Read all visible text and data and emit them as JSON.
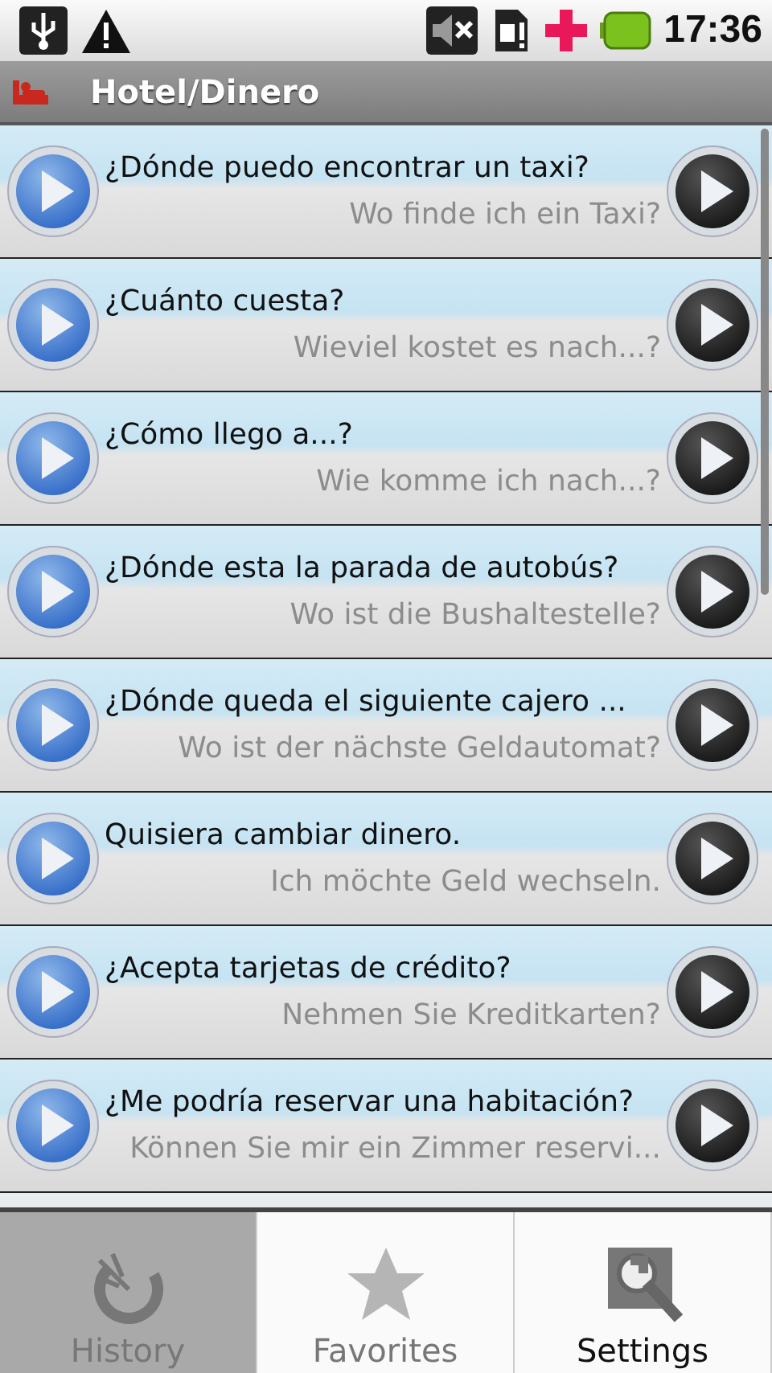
{
  "status_bar": {
    "time": "17:36"
  },
  "title_bar": {
    "title": "Hotel/Dinero"
  },
  "phrases": [
    {
      "question": "¿Dónde puedo encontrar un taxi?",
      "translation": "Wo finde ich ein Taxi?"
    },
    {
      "question": "¿Cuánto cuesta?",
      "translation": "Wieviel kostet es nach...?"
    },
    {
      "question": "¿Cómo llego a...?",
      "translation": "Wie komme ich nach...?"
    },
    {
      "question": "¿Dónde esta la parada de autobús?",
      "translation": "Wo ist die Bushaltestelle?"
    },
    {
      "question": "¿Dónde queda el siguiente cajero ...",
      "translation": "Wo ist der nächste Geldautomat?"
    },
    {
      "question": "Quisiera cambiar dinero.",
      "translation": "Ich möchte Geld wechseln."
    },
    {
      "question": "¿Acepta tarjetas de crédito?",
      "translation": "Nehmen Sie Kreditkarten?"
    },
    {
      "question": "¿Me podría reservar una habitación?",
      "translation": "Können Sie mir ein Zimmer reservi..."
    }
  ],
  "menu": [
    {
      "kind": "history",
      "label": "History",
      "selected": true,
      "disabled": true
    },
    {
      "kind": "favorites",
      "label": "Favorites",
      "selected": false,
      "disabled": true
    },
    {
      "kind": "settings",
      "label": "Settings",
      "selected": false,
      "disabled": false
    }
  ]
}
